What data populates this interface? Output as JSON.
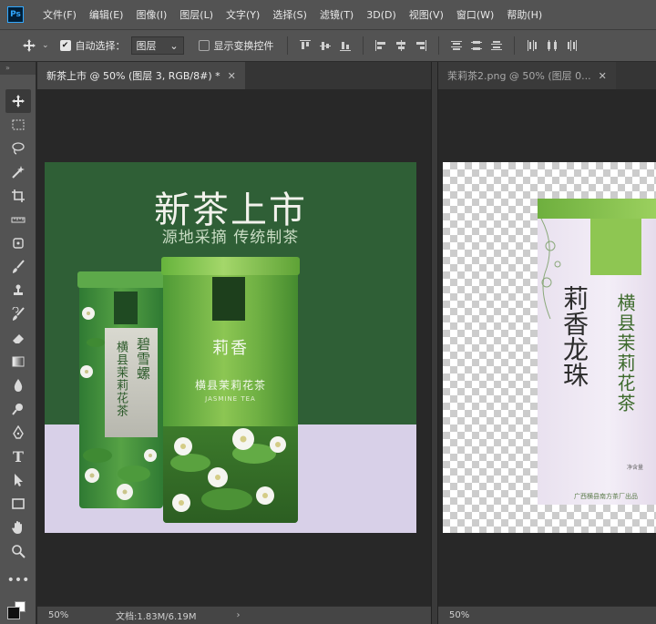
{
  "app": {
    "logo": "Ps"
  },
  "menu": [
    "文件(F)",
    "编辑(E)",
    "图像(I)",
    "图层(L)",
    "文字(Y)",
    "选择(S)",
    "滤镜(T)",
    "3D(D)",
    "视图(V)",
    "窗口(W)",
    "帮助(H)"
  ],
  "options": {
    "auto_select_label": "自动选择：",
    "auto_select_checked": true,
    "auto_select_target": "图层",
    "show_transform_label": "显示变换控件",
    "show_transform_checked": false
  },
  "tools": [
    "move-tool",
    "marquee-tool",
    "lasso-tool",
    "magic-wand-tool",
    "crop-tool",
    "ruler-tool",
    "patch-tool",
    "brush-tool",
    "stamp-tool",
    "history-brush-tool",
    "eraser-tool",
    "gradient-tool",
    "blur-tool",
    "dodge-tool",
    "pen-tool",
    "type-tool",
    "path-select-tool",
    "rectangle-tool",
    "hand-tool",
    "zoom-tool",
    "more-tools"
  ],
  "documents": [
    {
      "tab_title": "新茶上市 @ 50% (图层 3, RGB/8#) *",
      "active": true,
      "zoom": "50%",
      "doc_info": "文档:1.83M/6.19M",
      "artwork": {
        "headline": "新茶上市",
        "subheadline": "源地采摘 传统制茶",
        "back_can_text_1": "碧雪螺",
        "back_can_text_2": "横县茉莉花茶",
        "front_can_name": "莉香",
        "front_can_product": "横县茉莉花茶",
        "front_can_english": "JASMINE TEA"
      }
    },
    {
      "tab_title": "茉莉茶2.png @ 50% (图层 0...",
      "active": false,
      "zoom": "50%",
      "artwork": {
        "big_text": "莉香龙珠",
        "side_text": "横县茉莉花茶",
        "maker_text": "广西横县南方茶厂出品",
        "net_text": "净含量"
      }
    }
  ],
  "colors": {
    "ps_chrome": "#535353",
    "artboard_green": "#2f5f36",
    "artboard_lavender": "#d8d0e8"
  }
}
